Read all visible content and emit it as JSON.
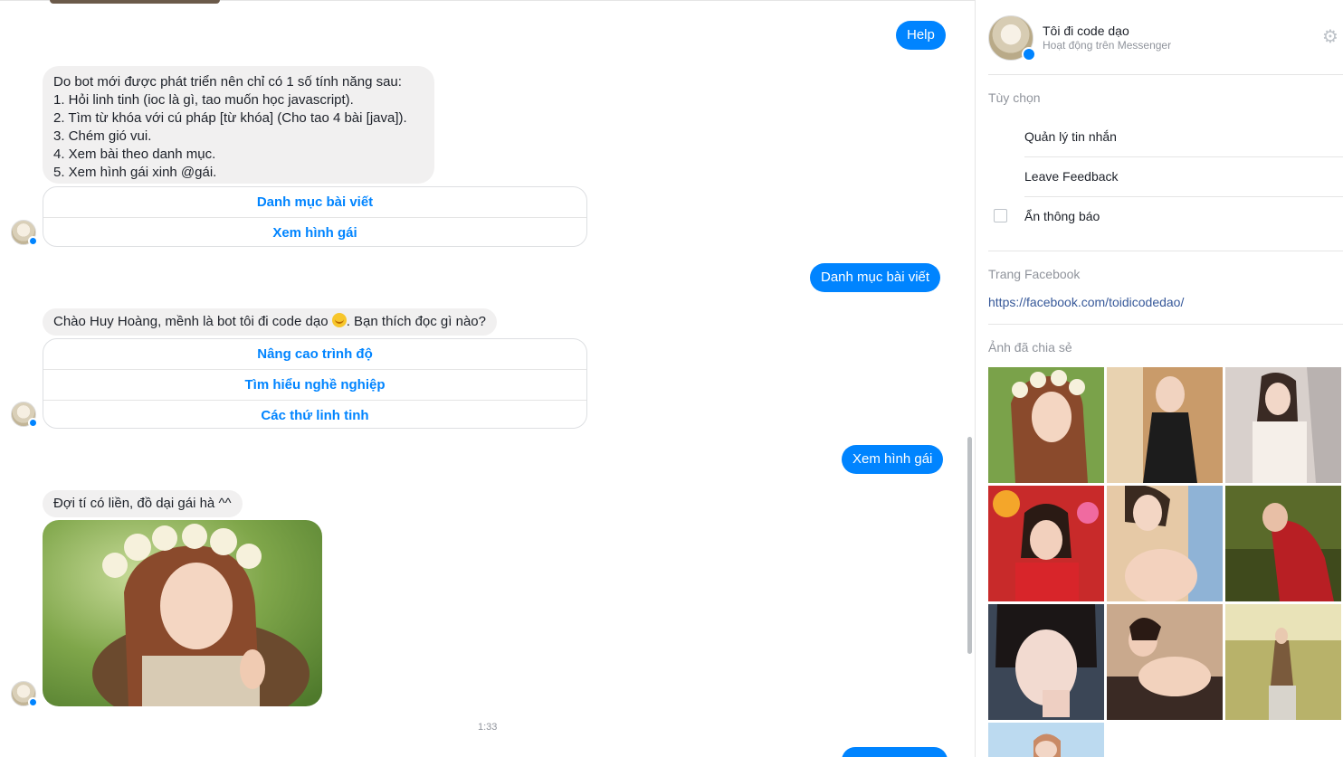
{
  "chat": {
    "messages": {
      "help": "Help",
      "bot_intro": "Do bot mới được phát triển nên chỉ có 1 số tính năng sau:\n1. Hỏi linh tinh (ioc là gì, tao muốn học javascript).\n2. Tìm từ khóa với cú pháp [từ khóa] (Cho tao 4 bài [java]).\n3. Chém gió vui.\n4. Xem bài theo danh mục.\n5. Xem hình gái xinh @gái.",
      "quick_replies_1": [
        "Danh mục bài viết",
        "Xem hình gái"
      ],
      "user_category": "Danh mục bài viết",
      "bot_greeting_before": "Chào Huy Hoàng, mềnh là bot tôi đi code dạo ",
      "bot_greeting_after": ". Bạn thích đọc gì nào?",
      "quick_replies_2": [
        "Nâng cao trình độ",
        "Tìm hiểu nghề nghiệp",
        "Các thứ linh tinh"
      ],
      "user_girls": "Xem hình gái",
      "bot_wait": "Đợi tí có liền, đồ dại gái hà ^^",
      "timestamp": "1:33"
    },
    "colors": {
      "accent": "#0084ff",
      "incoming_bg": "#f1f0f0"
    }
  },
  "panel": {
    "page_name": "Tôi đi code dạo",
    "status": "Hoạt động trên Messenger",
    "options_label": "Tùy chọn",
    "options": [
      "Quản lý tin nhắn",
      "Leave Feedback",
      "Ẩn thông báo"
    ],
    "facebook_label": "Trang Facebook",
    "facebook_url": "https://facebook.com/toidicodedao/",
    "shared_photos_label": "Ảnh đã chia sẻ",
    "icons": {
      "settings": "gear-icon",
      "messenger": "messenger-badge-icon"
    }
  }
}
